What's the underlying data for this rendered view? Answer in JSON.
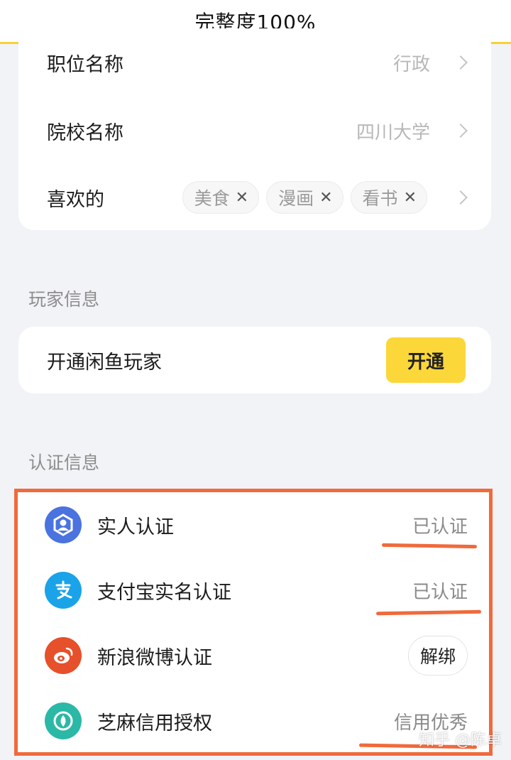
{
  "header": {
    "title": "完整度100%"
  },
  "profile": {
    "position": {
      "label": "职位名称",
      "value": "行政"
    },
    "school": {
      "label": "院校名称",
      "value": "四川大学"
    },
    "likes": {
      "label": "喜欢的",
      "tags": [
        "美食",
        "漫画",
        "看书"
      ],
      "remove_symbol": "✕"
    }
  },
  "player_section": {
    "title": "玩家信息",
    "row_label": "开通闲鱼玩家",
    "button_label": "开通"
  },
  "auth_section": {
    "title": "认证信息",
    "items": [
      {
        "label": "实人认证",
        "status": "已认证",
        "icon": "face-id-icon",
        "color": "#4a73e0"
      },
      {
        "label": "支付宝实名认证",
        "status": "已认证",
        "icon": "alipay-icon",
        "color": "#1aa3e8"
      },
      {
        "label": "新浪微博认证",
        "status": "解绑",
        "icon": "weibo-icon",
        "color": "#e6502b"
      },
      {
        "label": "芝麻信用授权",
        "status": "信用优秀",
        "icon": "sesame-credit-icon",
        "color": "#2bb8a6"
      }
    ]
  },
  "watermark": "知乎 @陈卓",
  "colors": {
    "accent_yellow": "#fcd73a",
    "annotation_orange": "#f06a3c"
  }
}
